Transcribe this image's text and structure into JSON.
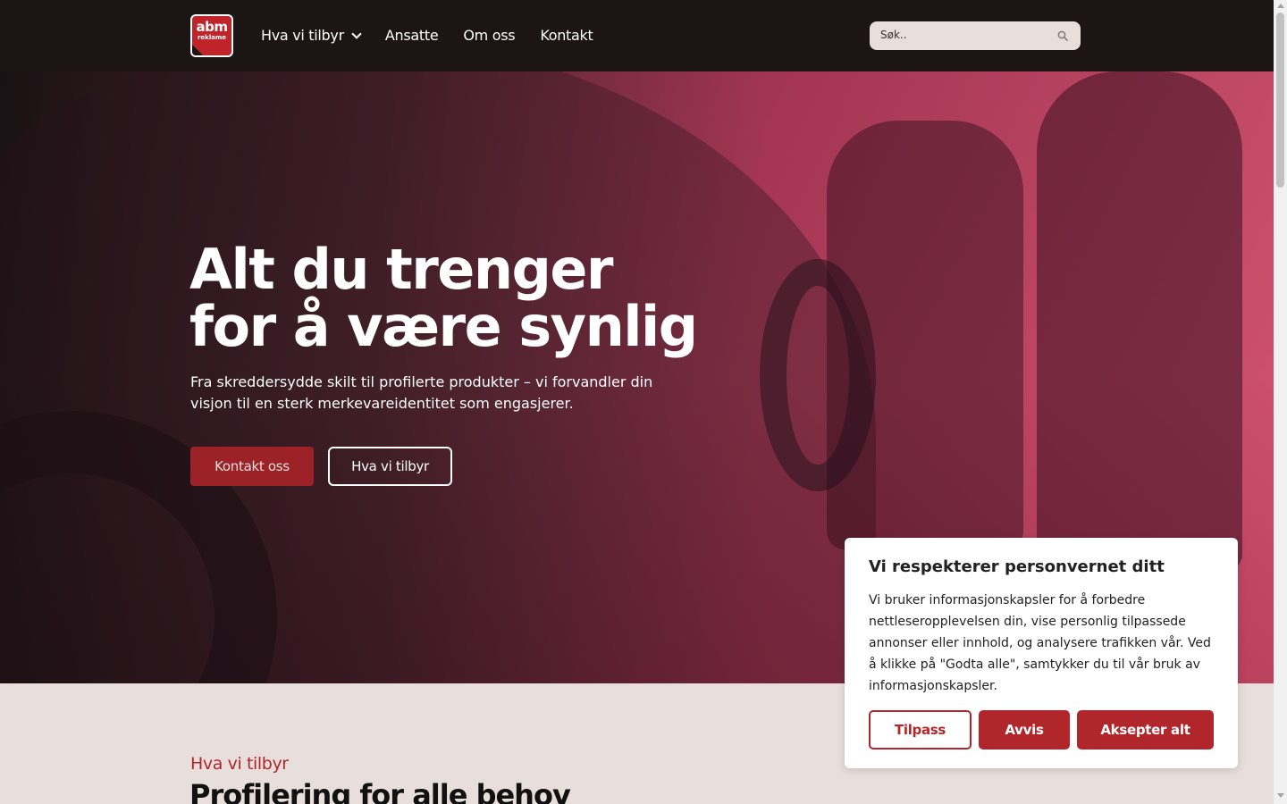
{
  "header": {
    "logo": {
      "line1": "abm",
      "line2": "reklame"
    },
    "nav": [
      {
        "label": "Hva vi tilbyr",
        "has_dropdown": true
      },
      {
        "label": "Ansatte"
      },
      {
        "label": "Om oss"
      },
      {
        "label": "Kontakt"
      }
    ],
    "search": {
      "placeholder": "Søk..",
      "icon": "search-icon"
    }
  },
  "hero": {
    "title_line1": "Alt du trenger",
    "title_line2": "for å være synlig",
    "subtitle": "Fra skreddersydde skilt til profilerte produkter – vi forvandler din visjon til en sterk merkevareidentitet som engasjerer.",
    "primary_button": "Kontakt oss",
    "secondary_button": "Hva vi tilbyr"
  },
  "section": {
    "eyebrow": "Hva vi tilbyr",
    "title": "Profilering for alle behov"
  },
  "cookie_banner": {
    "title": "Vi respekterer personvernet ditt",
    "text": "Vi bruker informasjonskapsler for å forbedre nettleseropplevelsen din, vise personlig tilpassede annonser eller innhold, og analysere trafikken vår. Ved å klikke på \"Godta alle\", samtykker du til vår bruk av informasjonskapsler.",
    "customize": "Tilpass",
    "reject": "Avvis",
    "accept": "Aksepter alt"
  },
  "colors": {
    "brand_red": "#b0262b",
    "header_bg": "#1d1414",
    "page_bg": "#e8dedb"
  }
}
